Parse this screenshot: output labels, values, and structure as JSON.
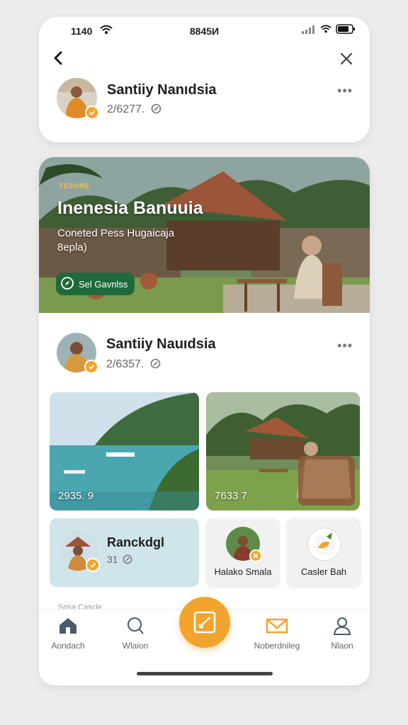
{
  "status": {
    "time": "1140",
    "center": "8845И"
  },
  "header": {
    "profile": {
      "name": "Santiiy Nanıdsia",
      "sub": "2/6277."
    }
  },
  "hero": {
    "kicker": "TESONE",
    "title": "Inenesia Banuuia",
    "subtitle": "Coneted Pess Hugaicaja 8epla)",
    "button_label": "Sel Gavnlss"
  },
  "post": {
    "name": "Santiiy Nauıdsia",
    "sub": "2/6357."
  },
  "tiles": [
    {
      "value": "2935. 9"
    },
    {
      "value": "7633 7"
    }
  ],
  "ranck": {
    "title": "Ranckdgl",
    "sub": "31"
  },
  "small_cards": [
    {
      "label": "Halako Smala"
    },
    {
      "label": "Casler Bah"
    }
  ],
  "peek_text": "Sosa Cascle",
  "tabs": [
    {
      "label": "Aondach",
      "icon": "home-icon"
    },
    {
      "label": "Wlaion",
      "icon": "search-icon"
    },
    {
      "label": "Noberdnileg",
      "icon": "mail-icon"
    },
    {
      "label": "Nlaon",
      "icon": "profile-icon"
    }
  ],
  "colors": {
    "accent": "#f2a42c",
    "hero_button": "#1f6a3c",
    "ranck_bg": "#cfe5ea"
  }
}
